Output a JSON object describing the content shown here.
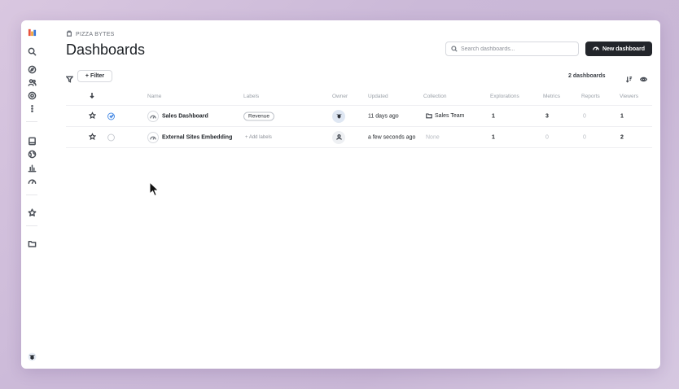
{
  "org": {
    "name": "PIZZA BYTES"
  },
  "page": {
    "title": "Dashboards"
  },
  "search": {
    "placeholder": "Search dashboards..."
  },
  "actions": {
    "new_dashboard": "New dashboard",
    "filter": "Filter"
  },
  "summary": {
    "count": "2 dashboards"
  },
  "columns": {
    "name": "Name",
    "labels": "Labels",
    "owner": "Owner",
    "updated": "Updated",
    "collection": "Collection",
    "explorations": "Explorations",
    "metrics": "Metrics",
    "reports": "Reports",
    "viewers": "Viewers"
  },
  "rows": [
    {
      "name": "Sales Dashboard",
      "label": "Revenue",
      "owner": "avatar",
      "updated": "11 days ago",
      "collection": "Sales Team",
      "explorations": "1",
      "metrics": "3",
      "reports": "0",
      "viewers": "1",
      "selected": true,
      "kebab": "⋮"
    },
    {
      "name": "External Sites Embedding",
      "label_action": "+ Add labels",
      "owner": "generic-user",
      "updated": "a few seconds ago",
      "collection": "None",
      "explorations": "1",
      "metrics": "0",
      "reports": "0",
      "viewers": "2",
      "selected": false,
      "kebab": "⋮"
    }
  ],
  "icons": {
    "rail": [
      "logo-icon",
      "search-icon",
      "compass-icon",
      "users-icon",
      "target-icon",
      "more-icon",
      "book-icon",
      "globe-icon",
      "chart-icon",
      "gauge-icon",
      "star-icon",
      "folder-icon",
      "avatar"
    ]
  },
  "colors": {
    "primary_button": "#23262b",
    "selected_check": "#4c8ee6",
    "background": "#ffffff"
  }
}
